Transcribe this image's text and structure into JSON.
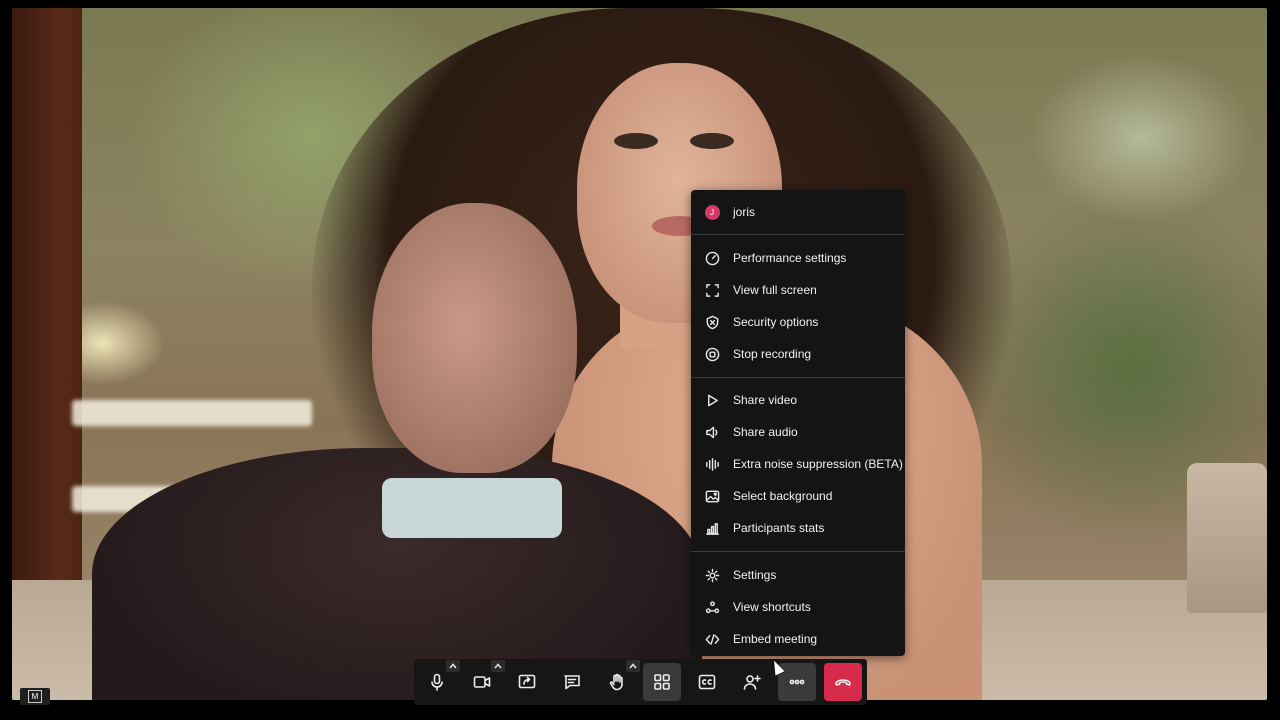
{
  "menu": {
    "user": {
      "initial": "J",
      "name": "joris"
    },
    "items": [
      {
        "label": "Performance settings",
        "icon": "gauge-icon"
      },
      {
        "label": "View full screen",
        "icon": "fullscreen-icon"
      },
      {
        "label": "Security options",
        "icon": "shield-icon"
      },
      {
        "label": "Stop recording",
        "icon": "record-icon"
      },
      {
        "label": "Share video",
        "icon": "play-icon"
      },
      {
        "label": "Share audio",
        "icon": "speaker-icon"
      },
      {
        "label": "Extra noise suppression (BETA)",
        "icon": "waveform-icon"
      },
      {
        "label": "Select background",
        "icon": "image-icon"
      },
      {
        "label": "Participants stats",
        "icon": "bar-chart-icon"
      },
      {
        "label": "Settings",
        "icon": "gear-icon"
      },
      {
        "label": "View shortcuts",
        "icon": "shortcuts-icon"
      },
      {
        "label": "Embed meeting",
        "icon": "code-icon"
      }
    ]
  },
  "toolbar": {
    "buttons": [
      "microphone-icon",
      "camera-icon",
      "screen-share-icon",
      "chat-icon",
      "raise-hand-icon",
      "tile-view-icon",
      "closed-captions-icon",
      "invite-icon",
      "more-icon",
      "hangup-icon"
    ],
    "hangup_color": "#d62b4a",
    "active_button": "tile-view-icon"
  },
  "badge": {
    "label": "M"
  }
}
